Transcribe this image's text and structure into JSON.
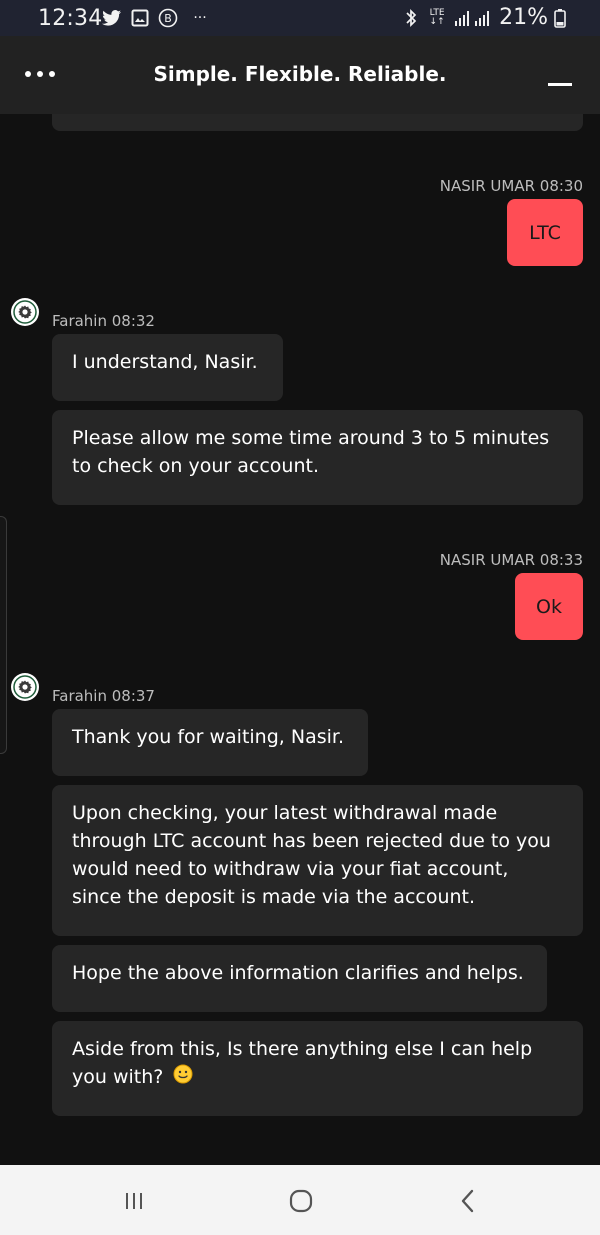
{
  "status_bar": {
    "time": "12:34",
    "overflow": "···",
    "lte_top": "LTE",
    "lte_bottom": "↓↑",
    "battery_percent": "21%",
    "icons": [
      "twitter-icon",
      "gallery-icon",
      "b-circle-icon",
      "bluetooth-icon",
      "signal-icon",
      "battery-icon"
    ]
  },
  "header": {
    "title": "Simple. Flexible. Reliable."
  },
  "messages": [
    {
      "author": "NASIR UMAR",
      "time": "08:30",
      "meta": "NASIR UMAR 08:30",
      "text": "LTC",
      "side": "user"
    },
    {
      "author": "Farahin",
      "time": "08:32",
      "meta": "Farahin 08:32",
      "side": "agent",
      "bubbles": [
        "I understand, Nasir.",
        "Please allow me some time around 3 to 5 minutes to check on your account."
      ]
    },
    {
      "author": "NASIR UMAR",
      "time": "08:33",
      "meta": "NASIR UMAR 08:33",
      "text": "Ok",
      "side": "user"
    },
    {
      "author": "Farahin",
      "time": "08:37",
      "meta": "Farahin 08:37",
      "side": "agent",
      "bubbles": [
        "Thank you for waiting, Nasir.",
        "Upon checking, your latest withdrawal made through LTC account has been rejected due to you would need to withdraw via your fiat account, since the deposit is made via the account.",
        "Hope the above information clarifies and helps.",
        "Aside from this, Is there anything else I can help you with?"
      ]
    }
  ],
  "last_bubble_emoji": "🙂",
  "colors": {
    "status_bar_bg": "#202331",
    "header_bg": "#222222",
    "chat_bg": "#111111",
    "agent_bubble": "#262626",
    "user_bubble": "#ff4d55",
    "nav_bar_bg": "#f4f4f4"
  },
  "nav": {
    "icons": [
      "recent-apps-icon",
      "home-icon",
      "back-icon"
    ]
  }
}
